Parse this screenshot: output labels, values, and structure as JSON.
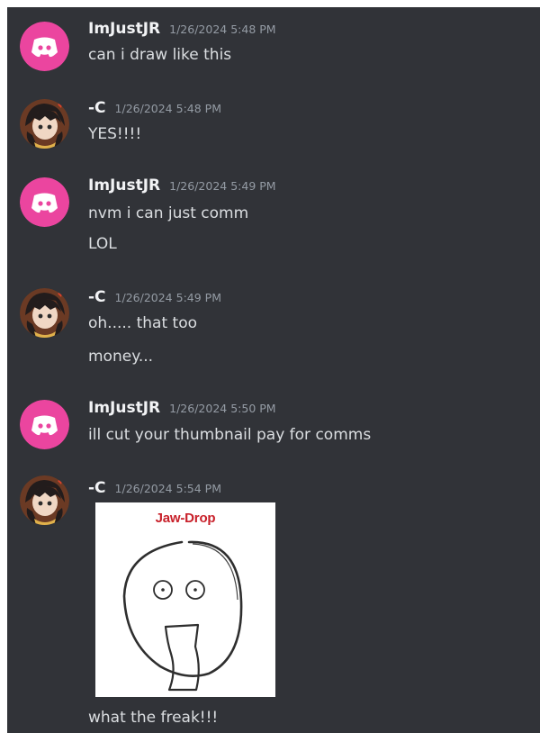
{
  "messages": [
    {
      "author": "ImJustJR",
      "timestamp": "1/26/2024 5:48 PM",
      "avatar": "discord-logo-icon",
      "avatar_color": "#eb459f",
      "lines": [
        "can i draw like this"
      ]
    },
    {
      "author": "-C",
      "timestamp": "1/26/2024 5:48 PM",
      "avatar": "anime-character-avatar",
      "lines": [
        "YES!!!!"
      ]
    },
    {
      "author": "ImJustJR",
      "timestamp": "1/26/2024 5:49 PM",
      "avatar": "discord-logo-icon",
      "avatar_color": "#eb459f",
      "lines": [
        "nvm i can just comm",
        "LOL"
      ]
    },
    {
      "author": "-C",
      "timestamp": "1/26/2024 5:49 PM",
      "avatar": "anime-character-avatar",
      "lines": [
        "oh..... that too",
        "money..."
      ]
    },
    {
      "author": "ImJustJR",
      "timestamp": "1/26/2024 5:50 PM",
      "avatar": "discord-logo-icon",
      "avatar_color": "#eb459f",
      "lines": [
        "ill cut your thumbnail pay for comms"
      ]
    },
    {
      "author": "-C",
      "timestamp": "1/26/2024 5:54 PM",
      "avatar": "anime-character-avatar",
      "attachment": {
        "caption_text": "Jaw-Drop",
        "caption_color": "#c8202a"
      },
      "lines": [
        "what the freak!!!"
      ]
    }
  ],
  "colors": {
    "background": "#313338",
    "author": "#f2f3f5",
    "timestamp": "#949ba4",
    "text": "#dbdee1"
  }
}
